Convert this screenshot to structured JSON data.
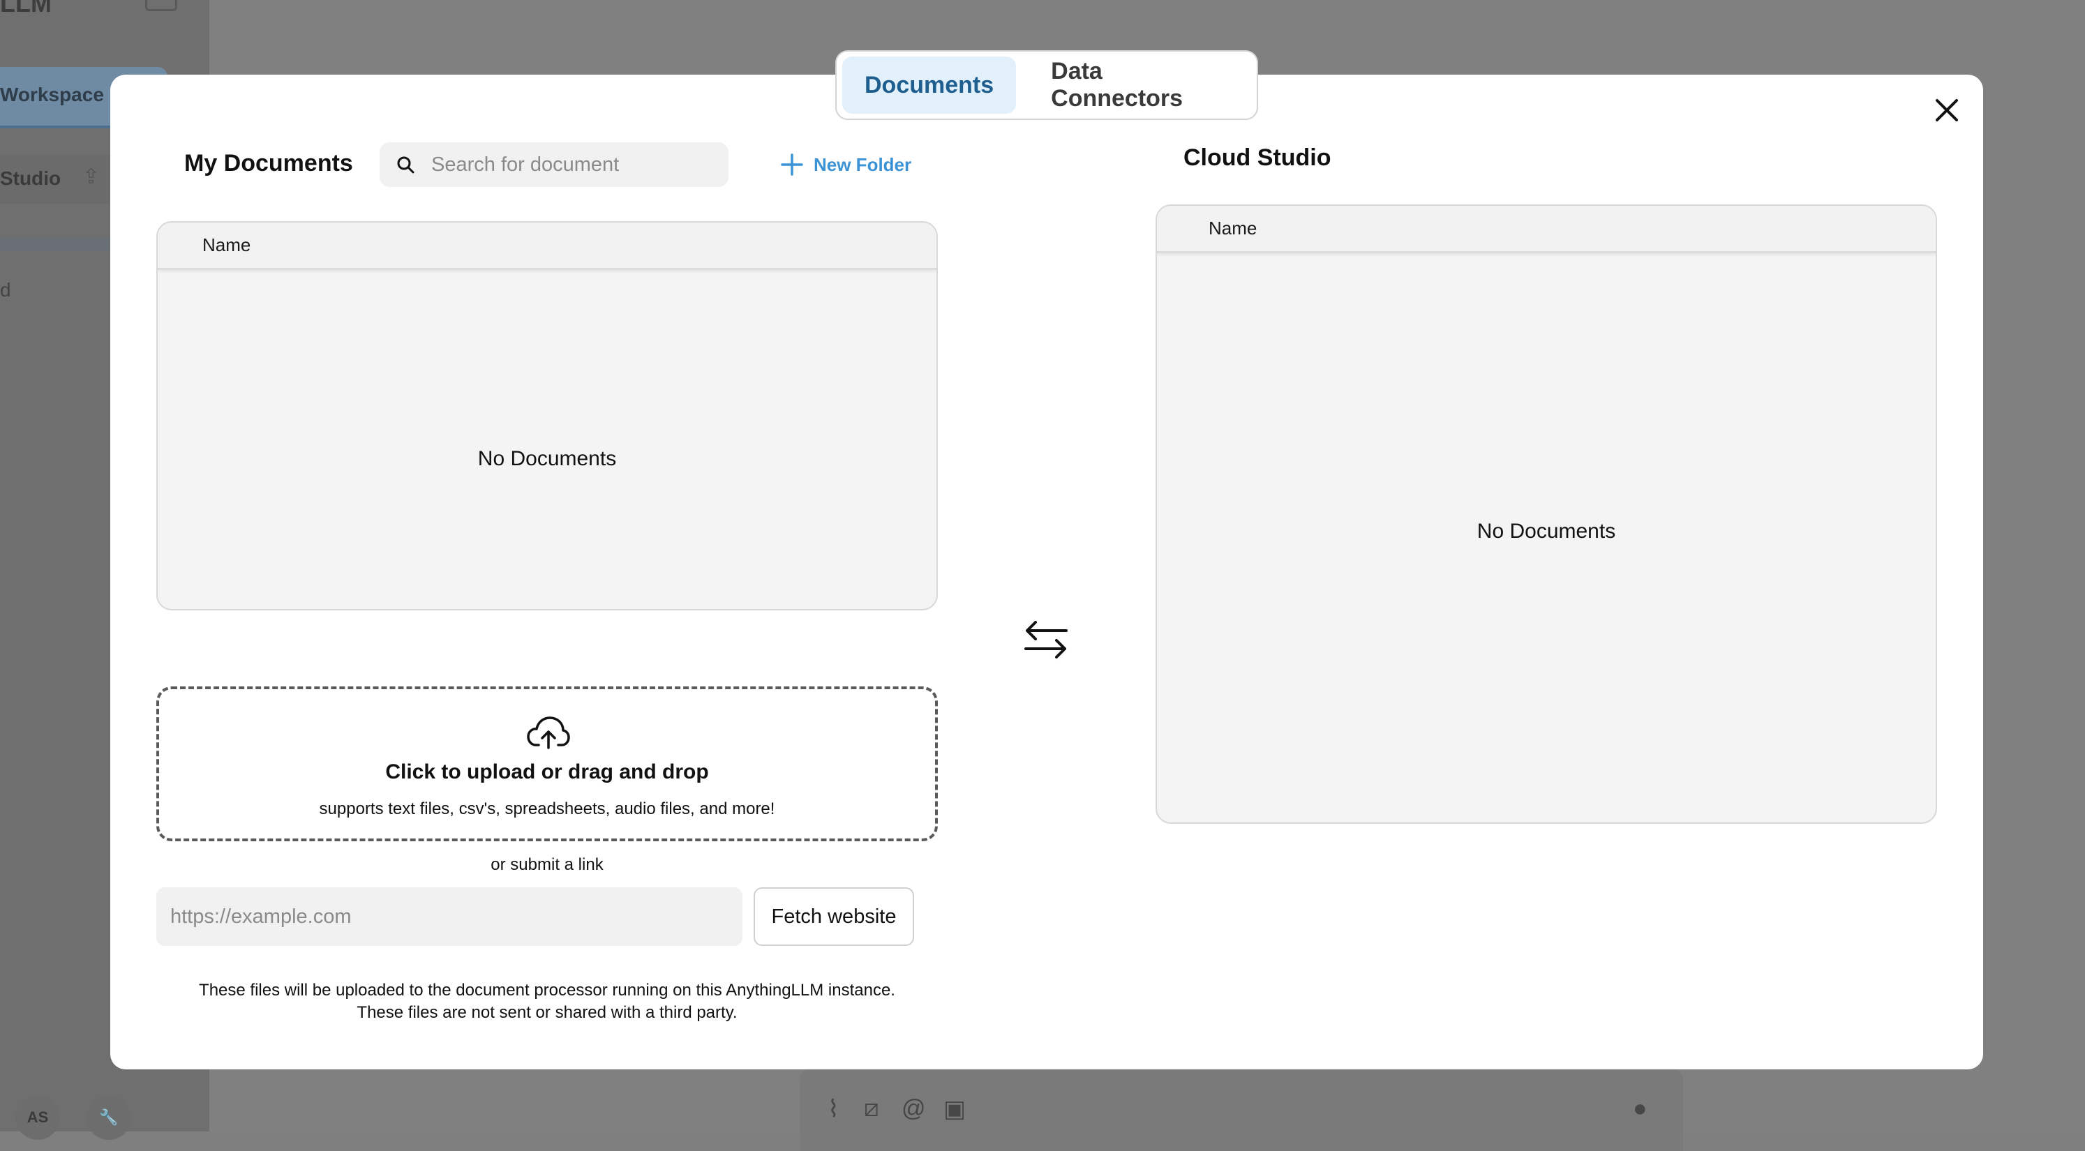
{
  "background": {
    "sidebar_title": "LLM",
    "workspace_label": "Workspace",
    "item_label": "Studio",
    "small_label": "d",
    "footer_badge": "AS"
  },
  "tabs": [
    {
      "label": "Documents",
      "active": true
    },
    {
      "label": "Data Connectors",
      "active": false
    }
  ],
  "my_documents": {
    "title": "My Documents",
    "search_placeholder": "Search for document",
    "new_folder_label": "New Folder",
    "column_name": "Name",
    "empty_text": "No Documents"
  },
  "upload": {
    "title": "Click to upload or drag and drop",
    "subtitle": "supports text files, csv's, spreadsheets, audio files, and more!",
    "or_link": "or submit a link",
    "url_placeholder": "https://example.com",
    "fetch_label": "Fetch website",
    "disclaimer_line1": "These files will be uploaded to the document processor running on this AnythingLLM instance.",
    "disclaimer_line2": "These files are not sent or shared with a third party."
  },
  "workspace_documents": {
    "title": "Cloud Studio",
    "column_name": "Name",
    "empty_text": "No Documents"
  },
  "icons": {
    "search": "search-icon",
    "plus": "plus-icon",
    "close": "close-icon",
    "upload": "cloud-upload-icon",
    "swap": "swap-arrows-icon"
  },
  "colors": {
    "accent": "#3b93d6",
    "active_tab_bg": "#e1f0fb",
    "active_tab_text": "#1f5f8f"
  }
}
